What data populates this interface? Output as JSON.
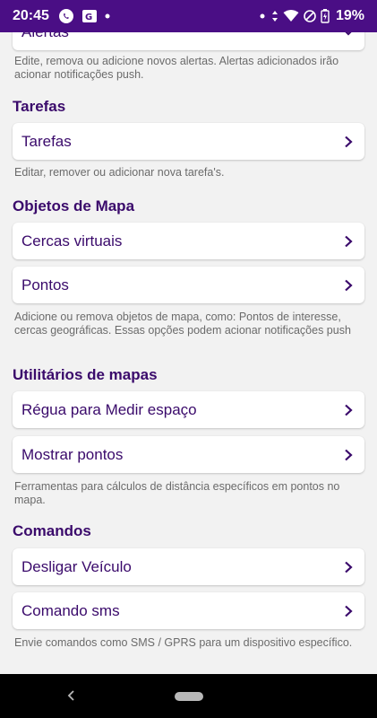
{
  "status": {
    "time": "20:45",
    "battery": "19%"
  },
  "sections": {
    "alertas": {
      "item_label": "Alertas",
      "description": "Edite, remova ou adicione novos alertas. Alertas adicionados irão acionar notificações push."
    },
    "tarefas": {
      "title": "Tarefas",
      "item_label": "Tarefas",
      "description": "Editar, remover ou adicionar nova tarefa's."
    },
    "objetos": {
      "title": "Objetos de Mapa",
      "items": [
        "Cercas virtuais",
        "Pontos"
      ],
      "description": "Adicione ou remova objetos de mapa, como: Pontos de interesse, cercas geográficas. Essas opções podem acionar notificações push"
    },
    "utilitarios": {
      "title": "Utilitários de mapas",
      "items": [
        "Régua para Medir espaço",
        "Mostrar pontos"
      ],
      "description": "Ferramentas para cálculos de distância específicos em pontos no mapa."
    },
    "comandos": {
      "title": "Comandos",
      "items": [
        "Desligar Veículo",
        "Comando sms"
      ],
      "description": "Envie comandos como SMS / GPRS para um dispositivo específico."
    }
  },
  "colors": {
    "status_bar": "#4a0e85",
    "accent_text": "#3a0a6b",
    "background": "#f2f2f2",
    "description_text": "#6b6b6b"
  },
  "icons": {
    "chevron": "chevron-right-icon",
    "status": [
      "whatsapp-icon",
      "translate-icon",
      "wifi-icon",
      "do-not-disturb-icon",
      "battery-icon"
    ]
  }
}
